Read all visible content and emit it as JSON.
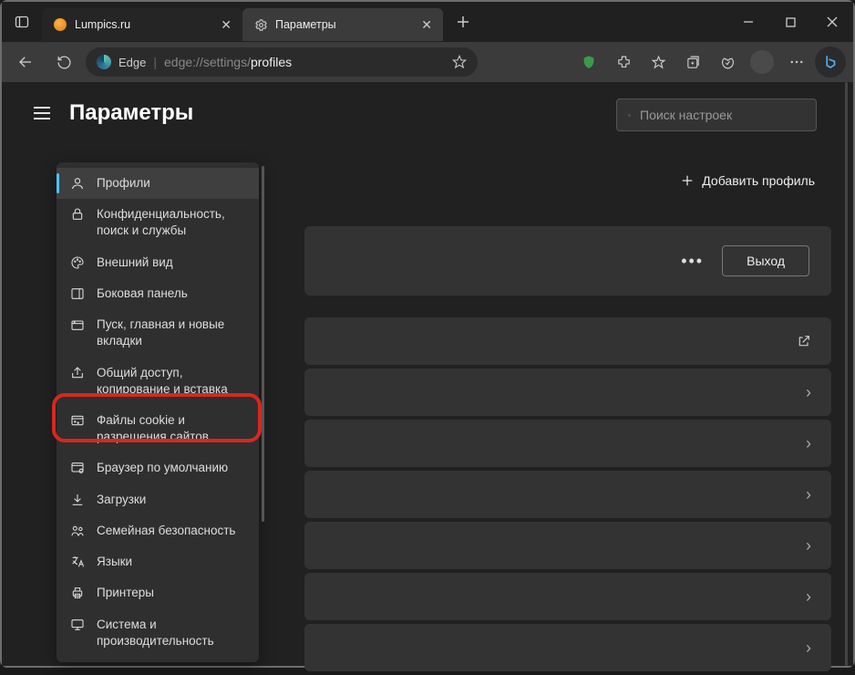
{
  "tabs": {
    "first": "Lumpics.ru",
    "second": "Параметры"
  },
  "addressbar": {
    "product": "Edge",
    "prefix": "edge://",
    "path_mid": "settings/",
    "path_end": "profiles"
  },
  "settings_title": "Параметры",
  "search": {
    "placeholder": "Поиск настроек"
  },
  "sidebar": {
    "items": [
      {
        "label": "Профили"
      },
      {
        "label": "Конфиденциальность, поиск и службы"
      },
      {
        "label": "Внешний вид"
      },
      {
        "label": "Боковая панель"
      },
      {
        "label": "Пуск, главная и новые вкладки"
      },
      {
        "label": "Общий доступ, копирование и вставка"
      },
      {
        "label": "Файлы cookie и разрешения сайтов"
      },
      {
        "label": "Браузер по умолчанию"
      },
      {
        "label": "Загрузки"
      },
      {
        "label": "Семейная безопасность"
      },
      {
        "label": "Языки"
      },
      {
        "label": "Принтеры"
      },
      {
        "label": "Система и производительность"
      }
    ]
  },
  "panel": {
    "add_profile": "Добавить профиль",
    "exit": "Выход"
  }
}
